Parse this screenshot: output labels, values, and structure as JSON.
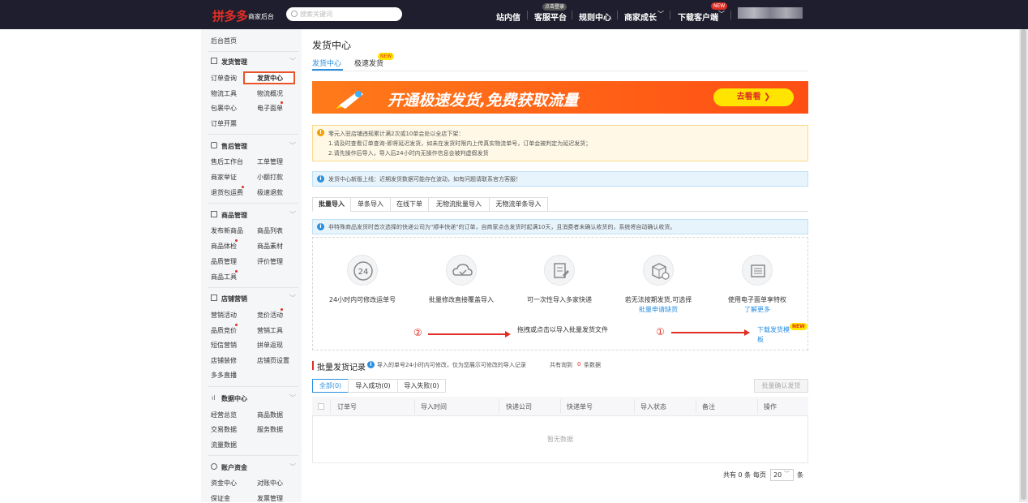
{
  "header": {
    "logo": "拼多多",
    "logo_sub": "商家后台",
    "search_placeholder": "搜索关键词",
    "nav": [
      "站内信",
      "客服平台",
      "规则中心",
      "商家成长",
      "下载客户端"
    ],
    "kefu_badge": "点击登录",
    "download_badge": "NEW"
  },
  "sidebar": {
    "home": "后台首页",
    "groups": [
      {
        "title": "发货管理",
        "items": [
          "订单查询",
          "发货中心",
          "物流工具",
          "物流概况",
          "包裹中心",
          "电子面单",
          "订单开票"
        ]
      },
      {
        "title": "售后管理",
        "items": [
          "售后工作台",
          "工单管理",
          "商家举证",
          "小额打款",
          "退货包运费",
          "极速退款"
        ]
      },
      {
        "title": "商品管理",
        "items": [
          "发布新商品",
          "商品列表",
          "商品体检",
          "商品素材",
          "品质管理",
          "评价管理",
          "商品工具"
        ]
      },
      {
        "title": "店铺营销",
        "items": [
          "营销活动",
          "竞价活动",
          "品质竞价",
          "营销工具",
          "短信营销",
          "拼单返现",
          "店铺装修",
          "店铺页设置",
          "多多直播"
        ]
      },
      {
        "title": "数据中心",
        "items": [
          "经营总览",
          "商品数据",
          "交易数据",
          "服务数据",
          "流量数据"
        ]
      },
      {
        "title": "账户资金",
        "items": [
          "资金中心",
          "对账中心",
          "保证金",
          "发票管理"
        ]
      }
    ]
  },
  "page": {
    "title": "发货中心",
    "tabs": [
      "发货中心",
      "极速发货"
    ],
    "tab_new_badge": "NEW"
  },
  "banner": {
    "text": "开通极速发货,免费获取流量",
    "button": "去看看 ❯"
  },
  "warning": {
    "lines": [
      "零元入驻店铺违规累计满2次或10单会处以全店下架：",
      "1.请及时查看订单查询-即将延迟发货，如未在发货时限内上传真实物流单号，订单会被判定为延迟发货；",
      "2.请先操作后导入，导入后24小时内无操作信息会被判虚假发货"
    ]
  },
  "notice": "发货中心新版上线：近期发货数据可能存在波动，如有问题请联系官方客服！",
  "import_tabs": [
    "批量导入",
    "单条导入",
    "在线下单",
    "无物流批量导入",
    "无物流单条导入"
  ],
  "notice2": "非特殊商品发货时首次选择的快递公司为\"顺丰快递\"的订单，自商家点击发货时起满10天，且消费者未确认收货的，系统将自动确认收货。",
  "features": [
    {
      "icon": "24h-icon",
      "text": "24小时内可修改运单号",
      "link": ""
    },
    {
      "icon": "cloud-upload-icon",
      "text": "批量修改直接覆盖导入",
      "link": ""
    },
    {
      "icon": "document-edit-icon",
      "text": "可一次性导入多家快递",
      "link": ""
    },
    {
      "icon": "package-icon",
      "text": "若无法按期发货,可选择",
      "link": "批量申请缺货"
    },
    {
      "icon": "list-icon",
      "text": "使用电子面单享特权",
      "link": "了解更多"
    }
  ],
  "upload": {
    "step2": "②",
    "step1": "①",
    "drop_text": "拖拽或点击以导入批量发货文件",
    "download_template": "下载发货模板",
    "download_new": "NEW"
  },
  "records": {
    "title": "批量发货记录",
    "hint": "导入的单号24小时内可修改，仅为您展示可修改的导入记录",
    "count_prefix": "共有询到",
    "count": "0",
    "count_suffix": "条数据",
    "status_tabs": [
      "全部(0)",
      "导入成功(0)",
      "导入失败(0)"
    ],
    "confirm_button": "批量确认发货",
    "columns": [
      "订单号",
      "导入时间",
      "快递公司",
      "快递单号",
      "导入状态",
      "备注",
      "操作"
    ],
    "empty": "暂无数据"
  },
  "pager": {
    "total": "共有 0 条",
    "per_page_label": "每页",
    "per_page": "20",
    "unit": "条"
  },
  "colors": {
    "brand": "#e02e24",
    "link": "#2b8fe0",
    "topbar": "#1e1e2e"
  }
}
